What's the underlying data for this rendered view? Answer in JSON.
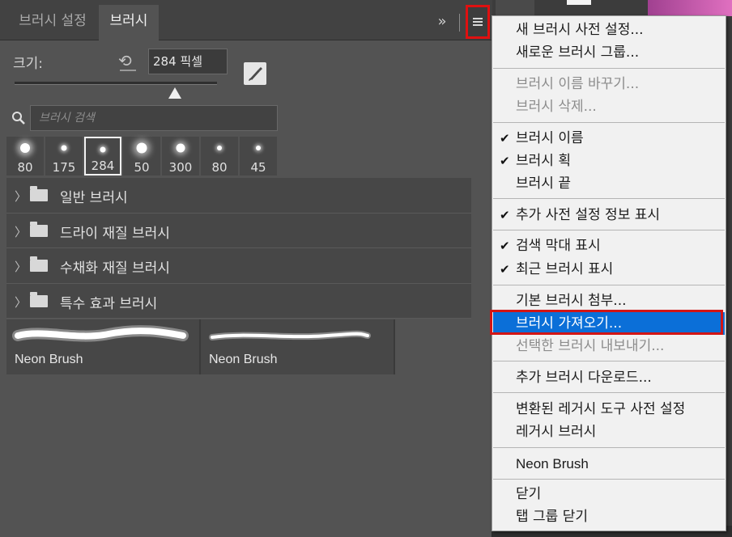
{
  "tabs": {
    "settings": "브러시 설정",
    "brushes": "브러시"
  },
  "icons": {
    "collapse": "»",
    "menu": "menu-icon",
    "reset": "reset-icon",
    "search": "search-icon",
    "new_brush": "new-brush-icon",
    "folder": "folder-icon",
    "chevron": "chevron-right-icon"
  },
  "size": {
    "label": "크기:",
    "value": "284 픽셀",
    "slider_fraction": 0.79
  },
  "search": {
    "placeholder": "브러시 검색"
  },
  "recent": [
    {
      "label": "80",
      "dot": 12
    },
    {
      "label": "175",
      "dot": 7
    },
    {
      "label": "284",
      "dot": 7,
      "selected": true
    },
    {
      "label": "50",
      "dot": 13
    },
    {
      "label": "300",
      "dot": 11
    },
    {
      "label": "80",
      "dot": 6
    },
    {
      "label": "45",
      "dot": 6
    }
  ],
  "groups": [
    "일반 브러시",
    "드라이 재질 브러시",
    "수채화 재질 브러시",
    "특수 효과 브러시"
  ],
  "brushes": [
    "Neon Brush",
    "Neon Brush"
  ],
  "menu": {
    "new_preset": "새 브러시 사전 설정...",
    "new_group": "새로운 브러시 그룹...",
    "rename": "브러시 이름 바꾸기...",
    "delete": "브러시 삭제...",
    "brush_name": "브러시 이름",
    "brush_stroke": "브러시 획",
    "brush_tip": "브러시 끝",
    "show_preset_info": "추가 사전 설정 정보 표시",
    "show_search_bar": "검색 막대 표시",
    "show_recent": "최근 브러시 표시",
    "append_default": "기본 브러시 첨부...",
    "import": "브러시 가져오기...",
    "export_selected": "선택한 브러시 내보내기...",
    "get_more": "추가 브러시 다운로드...",
    "convert_legacy": "변환된 레거시 도구 사전 설정",
    "legacy": "레거시 브러시",
    "neon": "Neon Brush",
    "close": "닫기",
    "close_group": "탭 그룹 닫기"
  },
  "colors": {
    "highlight": "#0b6fd8",
    "annotation": "#e01010"
  }
}
